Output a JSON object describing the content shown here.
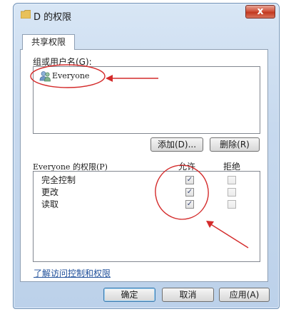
{
  "window": {
    "title": "D 的权限",
    "close_label": "x"
  },
  "tabs": [
    {
      "label": "共享权限"
    }
  ],
  "groups": {
    "label": "组或用户名(G):",
    "items": [
      {
        "name": "Everyone",
        "icon": "users-icon"
      }
    ],
    "add_button": "添加(D)...",
    "remove_button": "删除(R)"
  },
  "permissions": {
    "label": "Everyone 的权限(P)",
    "allow_header": "允许",
    "deny_header": "拒绝",
    "rows": [
      {
        "name": "完全控制",
        "allow": true,
        "deny": false
      },
      {
        "name": "更改",
        "allow": true,
        "deny": false
      },
      {
        "name": "读取",
        "allow": true,
        "deny": false
      }
    ]
  },
  "help_link": "了解访问控制和权限",
  "footer": {
    "ok_label": "确定",
    "cancel_label": "取消",
    "apply_label": "应用(A)"
  },
  "annotation_color": "#d42b2b"
}
